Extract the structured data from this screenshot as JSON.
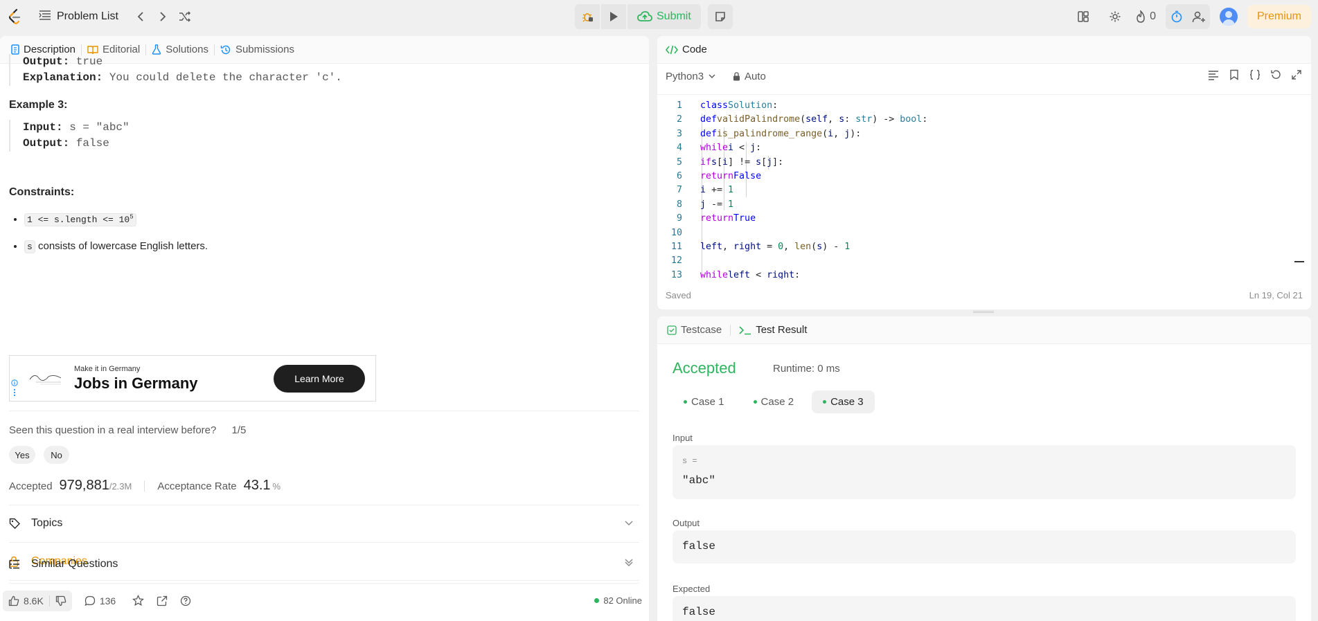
{
  "topbar": {
    "problem_list": "Problem List",
    "submit": "Submit",
    "streak": "0",
    "premium": "Premium"
  },
  "left_tabs": [
    {
      "label": "Description"
    },
    {
      "label": "Editorial"
    },
    {
      "label": "Solutions"
    },
    {
      "label": "Submissions"
    }
  ],
  "description": {
    "ex2_output_label": "Output:",
    "ex2_output_value": " true",
    "ex2_explanation_label": "Explanation:",
    "ex2_explanation_value": " You could delete the character 'c'.",
    "ex3_title": "Example 3:",
    "ex3_input_label": "Input:",
    "ex3_input_value": " s = \"abc\"",
    "ex3_output_label": "Output:",
    "ex3_output_value": " false",
    "constraints_title": "Constraints:",
    "constraint1_code": "1 <= s.length <= 10",
    "constraint1_sup": "5",
    "constraint2_code": "s",
    "constraint2_text": " consists of lowercase English letters."
  },
  "ad": {
    "small": "Make it in Germany",
    "big": "Jobs in Germany",
    "button": "Learn More"
  },
  "interview": {
    "question": "Seen this question in a real interview before?",
    "count": "1/5",
    "yes": "Yes",
    "no": "No"
  },
  "stats": {
    "accepted_label": "Accepted",
    "accepted_value": "979,881",
    "accepted_total": "/2.3M",
    "rate_label": "Acceptance Rate",
    "rate_value": "43.1",
    "rate_unit": "%"
  },
  "sections": {
    "topics": "Topics",
    "companies": "Companies",
    "similar": "Similar Questions"
  },
  "bottom": {
    "likes": "8.6K",
    "comments": "136",
    "online": "82 Online"
  },
  "code": {
    "title": "Code",
    "language": "Python3",
    "mode": "Auto",
    "saved": "Saved",
    "position": "Ln 19, Col 21",
    "line_numbers": [
      "1",
      "2",
      "3",
      "4",
      "5",
      "6",
      "7",
      "8",
      "9",
      "10",
      "11",
      "12",
      "13"
    ]
  },
  "test": {
    "testcase_tab": "Testcase",
    "result_tab": "Test Result",
    "status": "Accepted",
    "runtime": "Runtime: 0 ms",
    "cases": [
      "Case 1",
      "Case 2",
      "Case 3"
    ],
    "input_label": "Input",
    "input_var": "s =",
    "input_value": "\"abc\"",
    "output_label": "Output",
    "output_value": "false",
    "expected_label": "Expected",
    "expected_value": "false"
  },
  "colors": {
    "accent_green": "#2db55d",
    "premium_orange": "#e69500",
    "companies_orange": "#e69500"
  }
}
